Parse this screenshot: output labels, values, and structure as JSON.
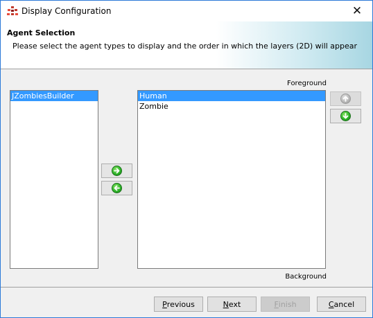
{
  "window": {
    "title": "Display Configuration",
    "close_glyph": "✕",
    "icons": {
      "app": "repast-app-icon",
      "close": "close-icon"
    }
  },
  "header": {
    "title": "Agent Selection",
    "description": "Please select the agent types to display and the order in which the layers (2D) will appear"
  },
  "labels": {
    "foreground": "Foreground",
    "background": "Background"
  },
  "available_agents": [
    {
      "label": "JZombiesBuilder",
      "selected": true
    }
  ],
  "selected_agents": [
    {
      "label": "Human",
      "selected": true
    },
    {
      "label": "Zombie",
      "selected": false
    }
  ],
  "arrow_buttons": {
    "add": {
      "icon": "arrow-right-icon",
      "enabled": true
    },
    "remove": {
      "icon": "arrow-left-icon",
      "enabled": true
    },
    "move_up": {
      "icon": "arrow-up-icon",
      "enabled": false
    },
    "move_down": {
      "icon": "arrow-down-icon",
      "enabled": true
    }
  },
  "footer": {
    "previous": {
      "mnemonic": "P",
      "rest": "revious",
      "enabled": true
    },
    "next": {
      "mnemonic": "N",
      "rest": "ext",
      "enabled": true
    },
    "finish": {
      "mnemonic": "F",
      "rest": "inish",
      "enabled": false
    },
    "cancel": {
      "mnemonic": "C",
      "rest": "ancel",
      "enabled": true
    }
  },
  "colors": {
    "selection": "#3399ff",
    "arrow_green": "#2fb52a",
    "window_border": "#2b79d8"
  }
}
